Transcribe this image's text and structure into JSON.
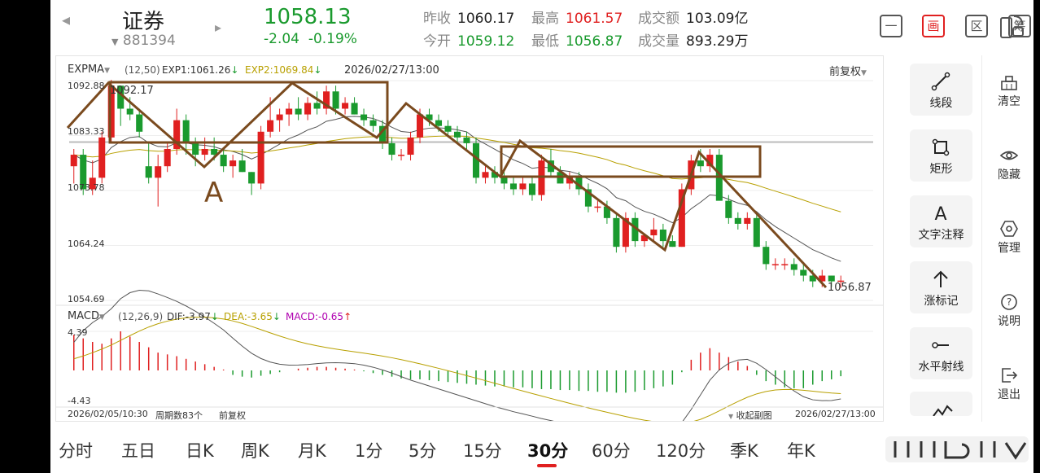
{
  "header": {
    "title": "证券",
    "code": "881394",
    "price": "1058.13",
    "change": "-2.04",
    "change_pct": "-0.19%",
    "stats": [
      {
        "label": "昨收",
        "value": "1060.17",
        "color": "#222222"
      },
      {
        "label": "最高",
        "value": "1061.57",
        "color": "#e02020"
      },
      {
        "label": "成交额",
        "value": "103.09亿",
        "color": "#222222"
      },
      {
        "label": "今开",
        "value": "1059.12",
        "color": "#1a9a2e"
      },
      {
        "label": "最低",
        "value": "1056.87",
        "color": "#1a9a2e"
      },
      {
        "label": "成交量",
        "value": "893.29万",
        "color": "#222222"
      }
    ],
    "buttons": [
      "一",
      "画",
      "区",
      "筹"
    ]
  },
  "main_chart": {
    "indicator": "EXPMA",
    "params": "(12,50)",
    "exp1": "EXP1:1061.26",
    "exp2": "EXP2:1069.84",
    "datetime": "2026/02/27/13:00",
    "adjust": "前复权",
    "y_ticks": [
      "1092.88",
      "1083.33",
      "1073.78",
      "1064.24",
      "1054.69"
    ],
    "high_label": "1092.17",
    "low_label": "1056.87",
    "annotation": "A"
  },
  "macd": {
    "name": "MACD",
    "params": "(12,26,9)",
    "dif": "DIF:-3.97",
    "dea": "DEA:-3.65",
    "macd": "MACD:-0.65",
    "top": "4.39",
    "bottom": "-4.43"
  },
  "footer": {
    "start": "2026/02/05/10:30",
    "periods": "周期数83个",
    "adjust": "前复权",
    "collapse": "收起副图",
    "end": "2026/02/27/13:00"
  },
  "tools": [
    "线段",
    "矩形",
    "文字注释",
    "涨标记",
    "水平射线"
  ],
  "side": [
    "清空",
    "隐藏",
    "管理",
    "说明",
    "退出"
  ],
  "tabs": [
    "分时",
    "五日",
    "日K",
    "周K",
    "月K",
    "1分",
    "5分",
    "15分",
    "30分",
    "60分",
    "120分",
    "季K",
    "年K"
  ],
  "active_tab": "30分",
  "colors": {
    "up": "#e02020",
    "down": "#1a9a2e",
    "accent": "#e02020",
    "drawing": "#7a4a1e"
  },
  "chart_data": {
    "type": "candlestick",
    "x_range": [
      "2026/02/05/10:30",
      "2026/02/27/13:00"
    ],
    "ylim": [
      1054.69,
      1092.88
    ],
    "candles": [
      [
        1078,
        1081,
        1075,
        1080
      ],
      [
        1080,
        1081,
        1073,
        1074
      ],
      [
        1074,
        1079,
        1073,
        1076
      ],
      [
        1076,
        1084,
        1075,
        1083
      ],
      [
        1083,
        1093,
        1082,
        1092
      ],
      [
        1092,
        1092,
        1085,
        1088
      ],
      [
        1088,
        1090,
        1086,
        1087
      ],
      [
        1087,
        1088,
        1083,
        1084
      ],
      [
        1078,
        1082,
        1075,
        1076
      ],
      [
        1076,
        1080,
        1071,
        1078
      ],
      [
        1078,
        1082,
        1077,
        1081
      ],
      [
        1081,
        1088,
        1080,
        1086
      ],
      [
        1086,
        1087,
        1080,
        1082
      ],
      [
        1082,
        1083,
        1078,
        1080
      ],
      [
        1080,
        1083,
        1079,
        1081
      ],
      [
        1081,
        1083,
        1079,
        1080
      ],
      [
        1080,
        1081,
        1077,
        1078
      ],
      [
        1078,
        1080,
        1076,
        1079
      ],
      [
        1079,
        1081,
        1077,
        1077
      ],
      [
        1077,
        1077,
        1073,
        1075
      ],
      [
        1075,
        1085,
        1074,
        1084
      ],
      [
        1084,
        1090,
        1083,
        1086
      ],
      [
        1086,
        1088,
        1084,
        1087
      ],
      [
        1087,
        1089,
        1085,
        1088
      ],
      [
        1088,
        1090,
        1086,
        1087
      ],
      [
        1087,
        1090,
        1086,
        1089
      ],
      [
        1089,
        1091,
        1087,
        1088
      ],
      [
        1088,
        1092,
        1087,
        1091
      ],
      [
        1091,
        1092,
        1087,
        1088
      ],
      [
        1088,
        1090,
        1087,
        1089
      ],
      [
        1089,
        1090,
        1087,
        1087
      ],
      [
        1087,
        1088,
        1085,
        1086
      ],
      [
        1086,
        1087,
        1084,
        1085
      ],
      [
        1085,
        1086,
        1081,
        1082
      ],
      [
        1082,
        1083,
        1079,
        1080
      ],
      [
        1080,
        1081,
        1079,
        1080
      ],
      [
        1080,
        1084,
        1079,
        1083
      ],
      [
        1083,
        1088,
        1082,
        1087
      ],
      [
        1087,
        1088,
        1085,
        1086
      ],
      [
        1086,
        1087,
        1084,
        1085
      ],
      [
        1085,
        1086,
        1083,
        1084
      ],
      [
        1084,
        1085,
        1082,
        1083
      ],
      [
        1083,
        1084,
        1081,
        1082
      ],
      [
        1082,
        1083,
        1075,
        1076
      ],
      [
        1076,
        1078,
        1075,
        1077
      ],
      [
        1077,
        1078,
        1075,
        1076
      ],
      [
        1076,
        1077,
        1074,
        1075
      ],
      [
        1075,
        1076,
        1073,
        1074
      ],
      [
        1074,
        1076,
        1073,
        1075
      ],
      [
        1075,
        1076,
        1072,
        1073
      ],
      [
        1073,
        1080,
        1072,
        1079
      ],
      [
        1079,
        1081,
        1076,
        1077
      ],
      [
        1077,
        1078,
        1075,
        1075
      ],
      [
        1075,
        1077,
        1074,
        1076
      ],
      [
        1076,
        1077,
        1073,
        1074
      ],
      [
        1074,
        1075,
        1070,
        1071
      ],
      [
        1071,
        1072,
        1070,
        1071
      ],
      [
        1071,
        1072,
        1068,
        1069
      ],
      [
        1069,
        1070,
        1063,
        1064
      ],
      [
        1064,
        1070,
        1063,
        1069
      ],
      [
        1069,
        1070,
        1064,
        1065
      ],
      [
        1065,
        1066,
        1064,
        1066
      ],
      [
        1066,
        1069,
        1065,
        1067
      ],
      [
        1067,
        1068,
        1064,
        1065
      ],
      [
        1065,
        1066,
        1064,
        1064
      ],
      [
        1064,
        1075,
        1064,
        1074
      ],
      [
        1074,
        1080,
        1073,
        1079
      ],
      [
        1079,
        1081,
        1077,
        1078
      ],
      [
        1078,
        1081,
        1077,
        1080
      ],
      [
        1080,
        1081,
        1073,
        1072
      ],
      [
        1072,
        1073,
        1068,
        1069
      ],
      [
        1069,
        1070,
        1067,
        1068
      ],
      [
        1068,
        1070,
        1067,
        1069
      ],
      [
        1069,
        1070,
        1064,
        1064
      ],
      [
        1064,
        1065,
        1060,
        1061
      ],
      [
        1061,
        1062,
        1060,
        1061
      ],
      [
        1061,
        1062,
        1060,
        1061
      ],
      [
        1061,
        1062,
        1059,
        1060
      ],
      [
        1060,
        1061,
        1058,
        1059
      ],
      [
        1059,
        1060,
        1057,
        1058
      ],
      [
        1058,
        1060,
        1057,
        1059
      ],
      [
        1059,
        1059,
        1057,
        1058
      ],
      [
        1058,
        1059,
        1056.87,
        1058.13
      ]
    ],
    "macd_hist": [
      4.0,
      3.6,
      3.2,
      3.0,
      3.6,
      4.39,
      3.8,
      3.2,
      2.6,
      2.0,
      1.8,
      1.6,
      1.3,
      1.0,
      0.7,
      0.4,
      0.1,
      -0.5,
      -0.7,
      -0.8,
      -0.6,
      -0.4,
      -0.2,
      0.0,
      0.2,
      0.3,
      0.4,
      0.4,
      0.3,
      0.2,
      0.1,
      -0.1,
      -0.3,
      -0.5,
      -0.7,
      -0.9,
      -1.0,
      -1.0,
      -1.1,
      -1.2,
      -1.3,
      -1.4,
      -1.5,
      -1.6,
      -1.7,
      -1.8,
      -1.8,
      -1.9,
      -1.9,
      -2.0,
      -2.1,
      -2.1,
      -2.2,
      -2.2,
      -2.3,
      -2.3,
      -2.4,
      -2.4,
      -2.5,
      -2.5,
      -2.4,
      -2.2,
      -2.0,
      -1.8,
      -1.6,
      -0.2,
      1.2,
      2.0,
      2.5,
      2.0,
      1.5,
      1.0,
      0.5,
      -0.5,
      -1.2,
      -1.6,
      -1.9,
      -2.0,
      -2.0,
      -1.6,
      -1.2,
      -1.0,
      -0.65
    ]
  }
}
